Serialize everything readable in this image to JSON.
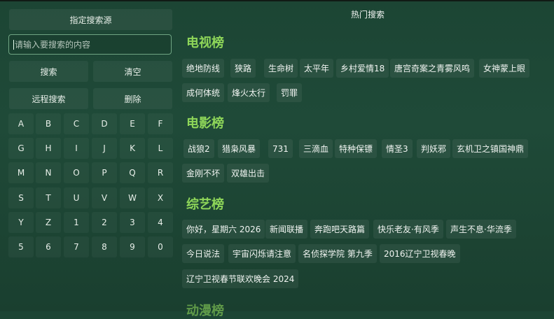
{
  "left": {
    "source_button": "指定搜索源",
    "search_placeholder": "请输入要搜索的内容",
    "search_button": "搜索",
    "clear_button": "清空",
    "remote_search_button": "远程搜索",
    "delete_button": "删除",
    "keys": [
      [
        "A",
        "B",
        "C",
        "D",
        "E",
        "F"
      ],
      [
        "G",
        "H",
        "I",
        "J",
        "K",
        "L"
      ],
      [
        "M",
        "N",
        "O",
        "P",
        "Q",
        "R"
      ],
      [
        "S",
        "T",
        "U",
        "V",
        "W",
        "X"
      ],
      [
        "Y",
        "Z",
        "1",
        "2",
        "3",
        "4"
      ],
      [
        "5",
        "6",
        "7",
        "8",
        "9",
        "0"
      ]
    ]
  },
  "right": {
    "title": "热门搜索",
    "sections": [
      {
        "title": "电视榜",
        "rows": [
          [
            "绝地防线",
            "狭路",
            "生命树",
            "太平年",
            "乡村爱情18",
            "唐宫奇案之青雾风鸣",
            "女神蒙上眼"
          ],
          [
            "成何体统",
            "烽火太行",
            "罚罪"
          ]
        ]
      },
      {
        "title": "电影榜",
        "rows": [
          [
            "战狼2",
            "猎枭风暴",
            "731",
            "三滴血",
            "特种保镖",
            "情圣3",
            "判妖邪",
            "玄机卫之镇国神鼎"
          ],
          [
            "金刚不坏",
            "双雄出击"
          ]
        ]
      },
      {
        "title": "综艺榜",
        "rows": [
          [
            "你好，星期六 2026",
            "新闻联播",
            "奔跑吧天路篇",
            "快乐老友·有风季",
            "声生不息·华流季"
          ],
          [
            "今日说法",
            "宇宙闪烁请注意",
            "名侦探学院 第九季",
            "2016辽宁卫视春晚"
          ],
          [
            "辽宁卫视春节联欢晚会 2024"
          ]
        ]
      }
    ],
    "partial_section_title": "动漫榜"
  }
}
